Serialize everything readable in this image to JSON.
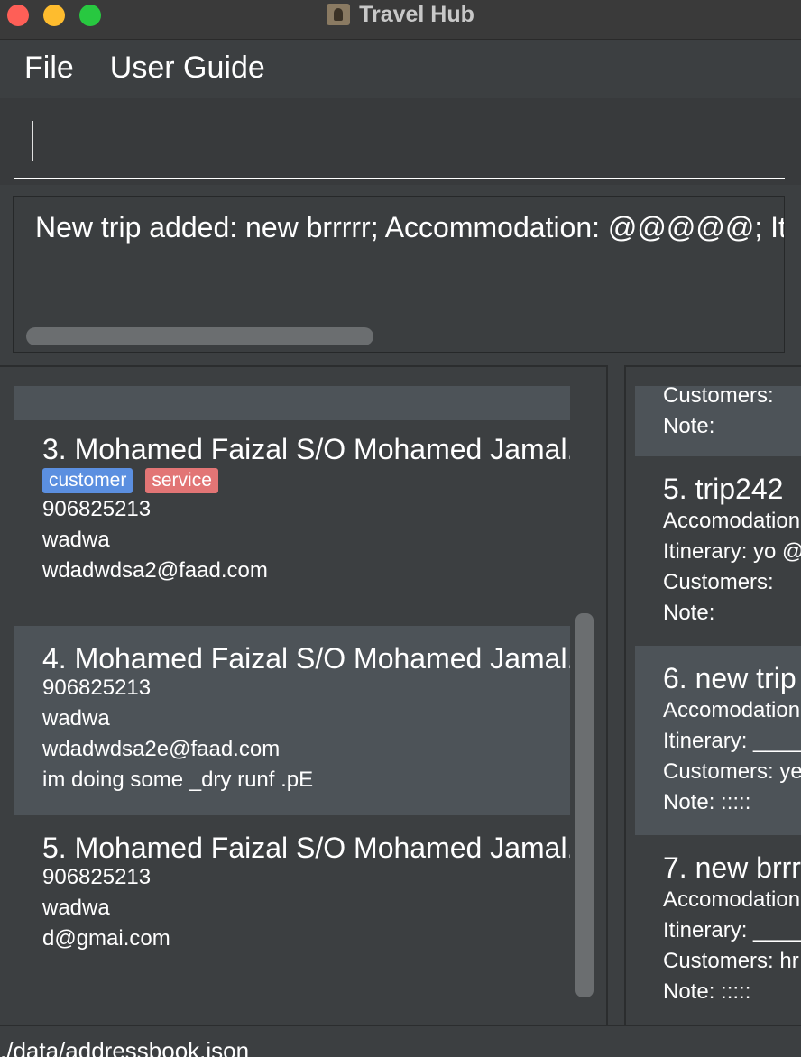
{
  "window": {
    "title": "Travel Hub"
  },
  "menu": {
    "file": "File",
    "user_guide": "User Guide"
  },
  "command": {
    "value": ""
  },
  "result": {
    "text": "New trip added: new brrrrr; Accommodation: @@@@@; It"
  },
  "persons": [
    {
      "name": "3. Mohamed Faizal S/O Mohamed Jamal...",
      "tags": [
        {
          "label": "customer",
          "color": "#5b8fe0"
        },
        {
          "label": "service",
          "color": "#e27575"
        }
      ],
      "phone": "906825213",
      "address": "wadwa",
      "email": "wdadwdsa2@faad.com",
      "remark": ""
    },
    {
      "name": "4. Mohamed Faizal S/O Mohamed Jamal...",
      "tags": [],
      "phone": "906825213",
      "address": "wadwa",
      "email": "wdadwdsa2e@faad.com",
      "remark": "im doing some _dry runf .pE"
    },
    {
      "name": "5. Mohamed Faizal S/O Mohamed Jamal...",
      "tags": [],
      "phone": "906825213",
      "address": "wadwa",
      "email": "d@gmai.com",
      "remark": ""
    }
  ],
  "trips": [
    {
      "name": "",
      "accommodation": "",
      "itinerary": "",
      "customers": "Customers:",
      "note": "Note:"
    },
    {
      "name": "5.  trip242",
      "accommodation": "Accomodation",
      "itinerary": "Itinerary: yo @",
      "customers": "Customers:",
      "note": "Note:"
    },
    {
      "name": "6.  new trip",
      "accommodation": "Accomodation",
      "itinerary": "Itinerary: _____",
      "customers": "Customers: ye",
      "note": "Note: :::::"
    },
    {
      "name": "7.  new brrrr",
      "accommodation": "Accomodation",
      "itinerary": "Itinerary: _____",
      "customers": "Customers: hr",
      "note": "Note: :::::"
    }
  ],
  "status": {
    "path": "./data/addressbook.json"
  }
}
